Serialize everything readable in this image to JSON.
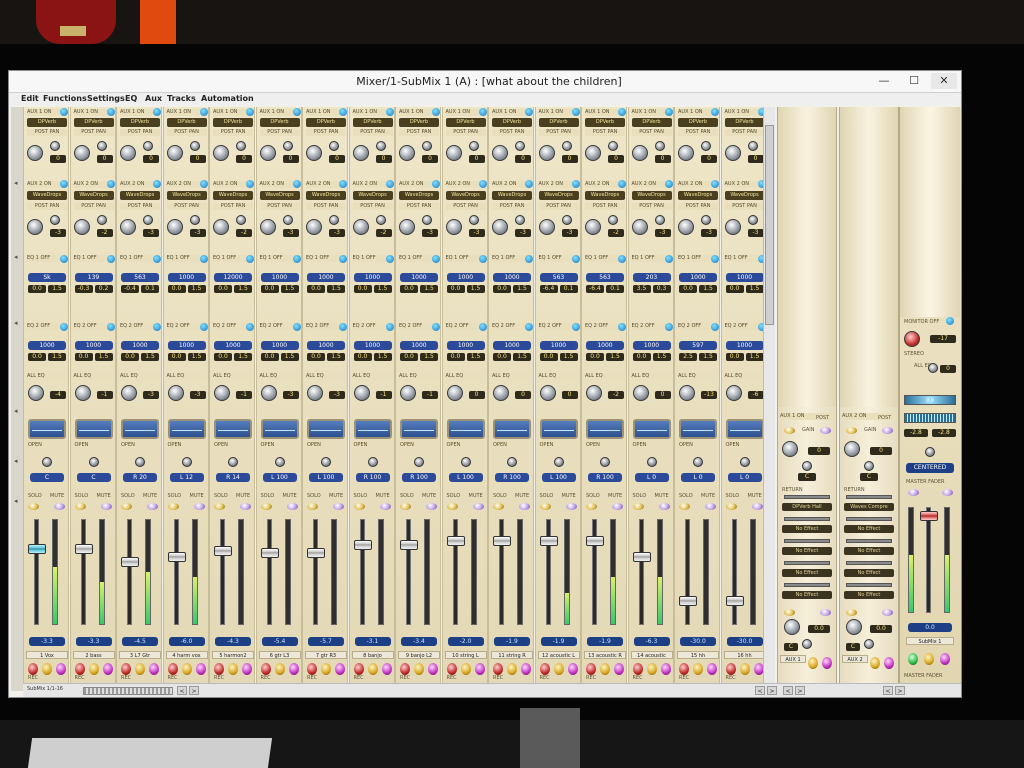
{
  "window": {
    "title": "Mixer/1-SubMix 1 (A) : [what about the children]",
    "min": "—",
    "max": "☐",
    "close": "✕"
  },
  "menu": [
    "Edit",
    "Functions",
    "Settings",
    "EQ",
    "Aux",
    "Tracks",
    "Automation"
  ],
  "channels": [
    {
      "aux1": "AUX 1 ON",
      "aux1_insert": "DPVerb",
      "aux1_mode": "POST PAN",
      "aux1_level": "0",
      "aux2": "AUX 2 ON",
      "aux2_insert": "WaveDrops",
      "aux2_mode": "POST PAN",
      "aux2_level": "-3",
      "eq1_freq": "Sk",
      "eq1_g": "0.0",
      "eq1_q": "1.5",
      "eq2_freq": "1000",
      "eq2_g": "0.0",
      "eq2_q": "1.5",
      "all_eq_level": "-4",
      "pan": "C",
      "volume": "-3.3",
      "name": "1 Vox",
      "fader": 0.74,
      "meter": 0.55,
      "selected": true
    },
    {
      "aux1": "AUX 1 ON",
      "aux1_insert": "DPVerb",
      "aux1_mode": "POST PAN",
      "aux1_level": "0",
      "aux2": "AUX 2 ON",
      "aux2_insert": "WaveDrops",
      "aux2_mode": "POST PAN",
      "aux2_level": "-2",
      "eq1_freq": "139",
      "eq1_g": "-0.3",
      "eq1_q": "0.2",
      "eq2_freq": "1000",
      "eq2_g": "0.0",
      "eq2_q": "1.5",
      "all_eq_level": "-1",
      "pan": "C",
      "volume": "-3.3",
      "name": "2 bass",
      "fader": 0.74,
      "meter": 0.4
    },
    {
      "aux1": "AUX 1 ON",
      "aux1_insert": "DPVerb",
      "aux1_mode": "POST PAN",
      "aux1_level": "0",
      "aux2": "AUX 2 ON",
      "aux2_insert": "WaveDrops",
      "aux2_mode": "POST PAN",
      "aux2_level": "-3",
      "eq1_freq": "563",
      "eq1_g": "-0.4",
      "eq1_q": "0.1",
      "eq2_freq": "1000",
      "eq2_g": "0.0",
      "eq2_q": "1.5",
      "all_eq_level": "-3",
      "pan": "R 20",
      "volume": "-4.5",
      "name": "3 L7 Gtr",
      "fader": 0.6,
      "meter": 0.5
    },
    {
      "aux1": "AUX 1 ON",
      "aux1_insert": "DPVerb",
      "aux1_mode": "POST PAN",
      "aux1_level": "0",
      "aux2": "AUX 2 ON",
      "aux2_insert": "WaveDrops",
      "aux2_mode": "POST PAN",
      "aux2_level": "-3",
      "eq1_freq": "1000",
      "eq1_g": "0.0",
      "eq1_q": "1.5",
      "eq2_freq": "1000",
      "eq2_g": "0.0",
      "eq2_q": "1.5",
      "all_eq_level": "-3",
      "pan": "L 12",
      "volume": "-6.0",
      "name": "4 harm vox",
      "fader": 0.66,
      "meter": 0.45
    },
    {
      "aux1": "AUX 1 ON",
      "aux1_insert": "DPVerb",
      "aux1_mode": "POST PAN",
      "aux1_level": "0",
      "aux2": "AUX 2 ON",
      "aux2_insert": "WaveDrops",
      "aux2_mode": "POST PAN",
      "aux2_level": "-2",
      "eq1_freq": "12000",
      "eq1_g": "0.0",
      "eq1_q": "1.5",
      "eq2_freq": "1000",
      "eq2_g": "0.0",
      "eq2_q": "1.5",
      "all_eq_level": "-1",
      "pan": "R 14",
      "volume": "-4.3",
      "name": "5 harmon2",
      "fader": 0.72,
      "meter": 0.0
    },
    {
      "aux1": "AUX 1 ON",
      "aux1_insert": "DPVerb",
      "aux1_mode": "POST PAN",
      "aux1_level": "0",
      "aux2": "AUX 2 ON",
      "aux2_insert": "WaveDrops",
      "aux2_mode": "POST PAN",
      "aux2_level": "-3",
      "eq1_freq": "1000",
      "eq1_g": "0.0",
      "eq1_q": "1.5",
      "eq2_freq": "1000",
      "eq2_g": "0.0",
      "eq2_q": "1.5",
      "all_eq_level": "-3",
      "pan": "L 100",
      "volume": "-5.4",
      "name": "6 gtr L3",
      "fader": 0.7,
      "meter": 0.0
    },
    {
      "aux1": "AUX 1 ON",
      "aux1_insert": "DPVerb",
      "aux1_mode": "POST PAN",
      "aux1_level": "0",
      "aux2": "AUX 2 ON",
      "aux2_insert": "WaveDrops",
      "aux2_mode": "POST PAN",
      "aux2_level": "-3",
      "eq1_freq": "1000",
      "eq1_g": "0.0",
      "eq1_q": "1.5",
      "eq2_freq": "1000",
      "eq2_g": "0.0",
      "eq2_q": "1.5",
      "all_eq_level": "-3",
      "pan": "L 100",
      "volume": "-5.7",
      "name": "7 gtr R3",
      "fader": 0.7,
      "meter": 0.0
    },
    {
      "aux1": "AUX 1 ON",
      "aux1_insert": "DPVerb",
      "aux1_mode": "POST PAN",
      "aux1_level": "0",
      "aux2": "AUX 2 ON",
      "aux2_insert": "WaveDrops",
      "aux2_mode": "POST PAN",
      "aux2_level": "-2",
      "eq1_freq": "1000",
      "eq1_g": "0.0",
      "eq1_q": "1.5",
      "eq2_freq": "1000",
      "eq2_g": "0.0",
      "eq2_q": "1.5",
      "all_eq_level": "-1",
      "pan": "R 100",
      "volume": "-3.1",
      "name": "8 banjo",
      "fader": 0.78,
      "meter": 0.0
    },
    {
      "aux1": "AUX 1 ON",
      "aux1_insert": "DPVerb",
      "aux1_mode": "POST PAN",
      "aux1_level": "0",
      "aux2": "AUX 2 ON",
      "aux2_insert": "WaveDrops",
      "aux2_mode": "POST PAN",
      "aux2_level": "-3",
      "eq1_freq": "1000",
      "eq1_g": "0.0",
      "eq1_q": "1.5",
      "eq2_freq": "1000",
      "eq2_g": "0.0",
      "eq2_q": "1.5",
      "all_eq_level": "-1",
      "pan": "R 100",
      "volume": "-3.4",
      "name": "9 banjo L2",
      "fader": 0.78,
      "meter": 0.0
    },
    {
      "aux1": "AUX 1 ON",
      "aux1_insert": "DPVerb",
      "aux1_mode": "POST PAN",
      "aux1_level": "0",
      "aux2": "AUX 2 ON",
      "aux2_insert": "WaveDrops",
      "aux2_mode": "POST PAN",
      "aux2_level": "-3",
      "eq1_freq": "1000",
      "eq1_g": "0.0",
      "eq1_q": "1.5",
      "eq2_freq": "1000",
      "eq2_g": "0.0",
      "eq2_q": "1.5",
      "all_eq_level": "0",
      "pan": "L 100",
      "volume": "-2.0",
      "name": "10 string L",
      "fader": 0.82,
      "meter": 0.0
    },
    {
      "aux1": "AUX 1 ON",
      "aux1_insert": "DPVerb",
      "aux1_mode": "POST PAN",
      "aux1_level": "0",
      "aux2": "AUX 2 ON",
      "aux2_insert": "WaveDrops",
      "aux2_mode": "POST PAN",
      "aux2_level": "-3",
      "eq1_freq": "1000",
      "eq1_g": "0.0",
      "eq1_q": "1.5",
      "eq2_freq": "1000",
      "eq2_g": "0.0",
      "eq2_q": "1.5",
      "all_eq_level": "0",
      "pan": "R 100",
      "volume": "-1.9",
      "name": "11 string R",
      "fader": 0.82,
      "meter": 0.0
    },
    {
      "aux1": "AUX 1 ON",
      "aux1_insert": "DPVerb",
      "aux1_mode": "POST PAN",
      "aux1_level": "0",
      "aux2": "AUX 2 ON",
      "aux2_insert": "WaveDrops",
      "aux2_mode": "POST PAN",
      "aux2_level": "-3",
      "eq1_freq": "563",
      "eq1_g": "-6.4",
      "eq1_q": "0.1",
      "eq2_freq": "1000",
      "eq2_g": "0.0",
      "eq2_q": "1.5",
      "all_eq_level": "0",
      "pan": "L 100",
      "volume": "-1.9",
      "name": "12 acoustic L",
      "fader": 0.82,
      "meter": 0.3
    },
    {
      "aux1": "AUX 1 ON",
      "aux1_insert": "DPVerb",
      "aux1_mode": "POST PAN",
      "aux1_level": "0",
      "aux2": "AUX 2 ON",
      "aux2_insert": "WaveDrops",
      "aux2_mode": "POST PAN",
      "aux2_level": "-2",
      "eq1_freq": "563",
      "eq1_g": "-6.4",
      "eq1_q": "0.1",
      "eq2_freq": "1000",
      "eq2_g": "0.0",
      "eq2_q": "1.5",
      "all_eq_level": "-2",
      "pan": "R 100",
      "volume": "-1.9",
      "name": "13 acoustic R",
      "fader": 0.82,
      "meter": 0.45
    },
    {
      "aux1": "AUX 1 ON",
      "aux1_insert": "DPVerb",
      "aux1_mode": "POST PAN",
      "aux1_level": "0",
      "aux2": "AUX 2 ON",
      "aux2_insert": "WaveDrops",
      "aux2_mode": "POST PAN",
      "aux2_level": "-3",
      "eq1_freq": "203",
      "eq1_g": "3.5",
      "eq1_q": "0.3",
      "eq2_freq": "1000",
      "eq2_g": "0.0",
      "eq2_q": "1.5",
      "all_eq_level": "0",
      "pan": "L 0",
      "volume": "-6.3",
      "name": "14 acoustic",
      "fader": 0.66,
      "meter": 0.45
    },
    {
      "aux1": "AUX 1 ON",
      "aux1_insert": "DPVerb",
      "aux1_mode": "POST PAN",
      "aux1_level": "0",
      "aux2": "AUX 2 ON",
      "aux2_insert": "WaveDrops",
      "aux2_mode": "POST PAN",
      "aux2_level": "-3",
      "eq1_freq": "1000",
      "eq1_g": "0.0",
      "eq1_q": "1.5",
      "eq2_freq": "597",
      "eq2_g": "2.5",
      "eq2_q": "1.5",
      "all_eq_level": "-13",
      "pan": "L 0",
      "volume": "-30.0",
      "name": "15 hh",
      "fader": 0.2,
      "meter": 0.0
    },
    {
      "aux1": "AUX 1 ON",
      "aux1_insert": "DPVerb",
      "aux1_mode": "POST PAN",
      "aux1_level": "0",
      "aux2": "AUX 2 ON",
      "aux2_insert": "WaveDrops",
      "aux2_mode": "POST PAN",
      "aux2_level": "-3",
      "eq1_freq": "1000",
      "eq1_g": "0.0",
      "eq1_q": "1.5",
      "eq2_freq": "1000",
      "eq2_g": "0.0",
      "eq2_q": "1.5",
      "all_eq_level": "-6",
      "pan": "L 0",
      "volume": "-30.0",
      "name": "16 hh",
      "fader": 0.2,
      "meter": 0.0
    }
  ],
  "labels": {
    "eq1": "EQ 1 OFF",
    "eq2": "EQ 2 OFF",
    "all_eq": "ALL EQ",
    "open": "OPEN",
    "solo": "SOLO",
    "mute": "MUTE",
    "rec": "REC",
    "plus": "+",
    "db": "dB",
    "q": "Q",
    "freq_hint": "8V"
  },
  "busses": [
    {
      "header": "AUX 1 ON",
      "mode": "POST",
      "gain_label": "GAIN",
      "gain": "0",
      "pan": "C",
      "return": "RETURN",
      "insert": "DPVerb Hall",
      "slots": [
        "No Effect",
        "No Effect",
        "No Effect",
        "No Effect"
      ],
      "level": "0.0",
      "pan2": "C",
      "name": "AUX 1"
    },
    {
      "header": "AUX 2 ON",
      "mode": "POST",
      "gain_label": "GAIN",
      "gain": "0",
      "pan": "C",
      "return": "RETURN",
      "insert": "Waves Compre",
      "slots": [
        "No Effect",
        "No Effect",
        "No Effect",
        "No Effect"
      ],
      "level": "0.0",
      "pan2": "C",
      "name": "AUX 2"
    }
  ],
  "master": {
    "monitor": "MONITOR OFF",
    "mon_level": "-17",
    "stereo": "STEREO",
    "all_eq": "ALL EQ",
    "level": "0",
    "display": "0.0",
    "vals": [
      "-2.8",
      "-2.8"
    ],
    "centered": "CENTERED",
    "label": "MASTER FADER",
    "volume": "0.0",
    "name": "SubMix 1",
    "bottom": "MASTER FADER"
  },
  "hscroll": {
    "left_label": "SubMix 1/1-16",
    "nav_prev": "<",
    "nav_next": ">"
  }
}
